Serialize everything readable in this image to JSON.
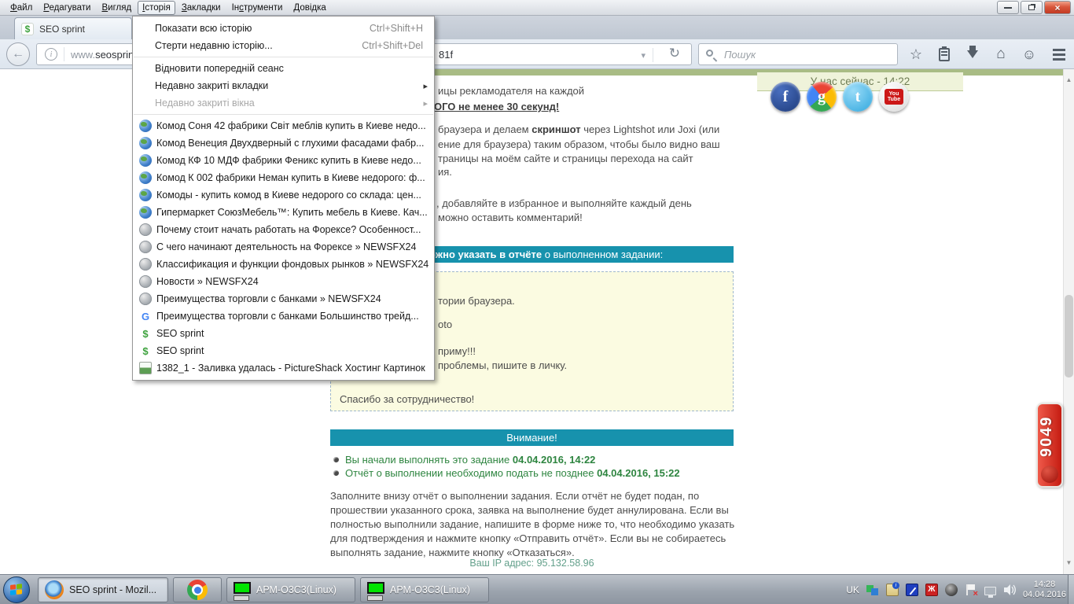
{
  "icons": {
    "back_glyph": "←",
    "dropdown_glyph": "▾",
    "reload_glyph": "↻",
    "star_glyph": "☆",
    "home_glyph": "⌂",
    "smiley_glyph": "☺",
    "info_glyph": "i",
    "scroll_up_glyph": "▲",
    "scroll_down_glyph": "▼",
    "close_glyph": "×"
  },
  "menubar": {
    "items": [
      {
        "pre": "",
        "key": "Ф",
        "rest": "айл"
      },
      {
        "pre": "",
        "key": "Р",
        "rest": "едагувати"
      },
      {
        "pre": "",
        "key": "В",
        "rest": "игляд"
      },
      {
        "pre": "",
        "key": "І",
        "rest": "сторія",
        "active": true
      },
      {
        "pre": "",
        "key": "З",
        "rest": "акладки"
      },
      {
        "pre": "Ін",
        "key": "с",
        "rest": "трументи"
      },
      {
        "pre": "",
        "key": "Д",
        "rest": "овідка"
      }
    ]
  },
  "tabbar": {
    "active_tab": "SEO sprint"
  },
  "navbar": {
    "url_www": "www.",
    "url_domain": "seosprint.ne",
    "url_tail": "81f",
    "search_placeholder": "Пошук"
  },
  "history_menu": {
    "commands": [
      {
        "label": "Показати всю історію",
        "shortcut": "Ctrl+Shift+H"
      },
      {
        "label": "Стерти недавню історію...",
        "shortcut": "Ctrl+Shift+Del"
      }
    ],
    "session": [
      {
        "label": "Відновити попередній сеанс"
      },
      {
        "label": "Недавно закриті вкладки",
        "submenu": true
      },
      {
        "label": "Недавно закриті вікна",
        "submenu": true,
        "disabled": true
      }
    ],
    "entries": [
      {
        "icon": "globe-color",
        "label": "Комод Соня 42 фабрики Світ меблів купить в Киеве недо..."
      },
      {
        "icon": "globe-color",
        "label": "Комод Венеция Двухдверный с глухими фасадами фабр..."
      },
      {
        "icon": "globe-color",
        "label": "Комод КФ 10 МДФ фабрики Феникс купить в Киеве недо..."
      },
      {
        "icon": "globe-color",
        "label": "Комод К 002 фабрики Неман купить в Киеве недорого: ф..."
      },
      {
        "icon": "globe-color",
        "label": "Комоды - купить комод в Киеве недорого со склада: цен..."
      },
      {
        "icon": "globe-color",
        "label": "Гипермаркет СоюзМебель™: Купить мебель в Киеве. Кач..."
      },
      {
        "icon": "globe-gray",
        "label": "Почему стоит начать работать на Форексе? Особенност..."
      },
      {
        "icon": "globe-gray",
        "label": "С чего начинают деятельность на Форексе » NEWSFX24"
      },
      {
        "icon": "globe-gray",
        "label": "Классификация и функции фондовых рынков » NEWSFX24"
      },
      {
        "icon": "globe-gray",
        "label": "Новости » NEWSFX24"
      },
      {
        "icon": "globe-gray",
        "label": "Преимущества торговли с банками » NEWSFX24"
      },
      {
        "icon": "google",
        "label": "Преимущества торговли с банками Большинство трейд..."
      },
      {
        "icon": "seosprint",
        "label": "SEO sprint"
      },
      {
        "icon": "seosprint",
        "label": "SEO sprint"
      },
      {
        "icon": "pictureshack",
        "label": "1382_1 - Заливка удалась - PictureShack Хостинг Картинок"
      }
    ]
  },
  "page": {
    "intro": {
      "l1": "ицы рекламодателя на каждой",
      "l2": "ОГО не менее 30 секунд!",
      "l3a": "браузера и делаем ",
      "l3b": "скриншот",
      "l3c": " через Lightshot или Joxi (или",
      "l4": "ение для браузера) таким образом, чтобы было видно ваш",
      "l5": "траницы на моём сайте и страницы перехода на сайт",
      "l6": "ия.",
      "l7": ", добавляйте в избранное и выполняйте каждый день",
      "l8": "можно оставить комментарий!"
    },
    "report_header": {
      "bold": "Что можно указать в отчёте",
      "rest": " о выполненном задании:"
    },
    "note": {
      "n1": "тории браузера.",
      "n2": "oto",
      "n3": "приму!!!",
      "n4": "проблемы, пишите в личку.",
      "n5": "Спасибо за сотрудничество!"
    },
    "attention": {
      "title": "Внимание!",
      "bullet1_text": "Вы начали выполнять это задание ",
      "bullet1_date": "04.04.2016, 14:22",
      "bullet2_text": "Отчёт о выполнении необходимо подать не позднее ",
      "bullet2_date": "04.04.2016, 15:22",
      "paragraph": "Заполните внизу отчёт о выполнении задания. Если отчёт не будет подан, по прошествии указанного срока, заявка на выполнение будет аннулирована. Если вы полностью выполнили задание, напишите в форме ниже то, что необходимо указать для подтверждения и нажмите кнопку «Отправить отчёт». Если вы не собираетесь выполнять задание, нажмите кнопку «Отказаться».",
      "ip_line": "Ваш IP адрес: 95.132.58.96"
    },
    "sidebar": {
      "online_header": "У нас сейчас - 14:22",
      "social": [
        {
          "name": "facebook",
          "label": "f"
        },
        {
          "name": "google",
          "label": "g"
        },
        {
          "name": "twitter",
          "label": "t"
        },
        {
          "name": "youtube",
          "label": "You Tube"
        }
      ],
      "visitors_count": "9049"
    }
  },
  "taskbar": {
    "firefox_label": "SEO sprint - Mozil...",
    "apm1_label": "АРМ-О3С3(Linux)",
    "apm2_label": "АРМ-О3С3(Linux)",
    "tray": {
      "language": "UK",
      "time": "14:28",
      "date": "04.04.2016"
    }
  },
  "colors": {
    "teal_bar": "#1792ad",
    "green_text": "#2e8540",
    "note_bg": "#fbfbe1",
    "badge_red": "#c51c12",
    "header_strip_green": "#a9bc85"
  }
}
